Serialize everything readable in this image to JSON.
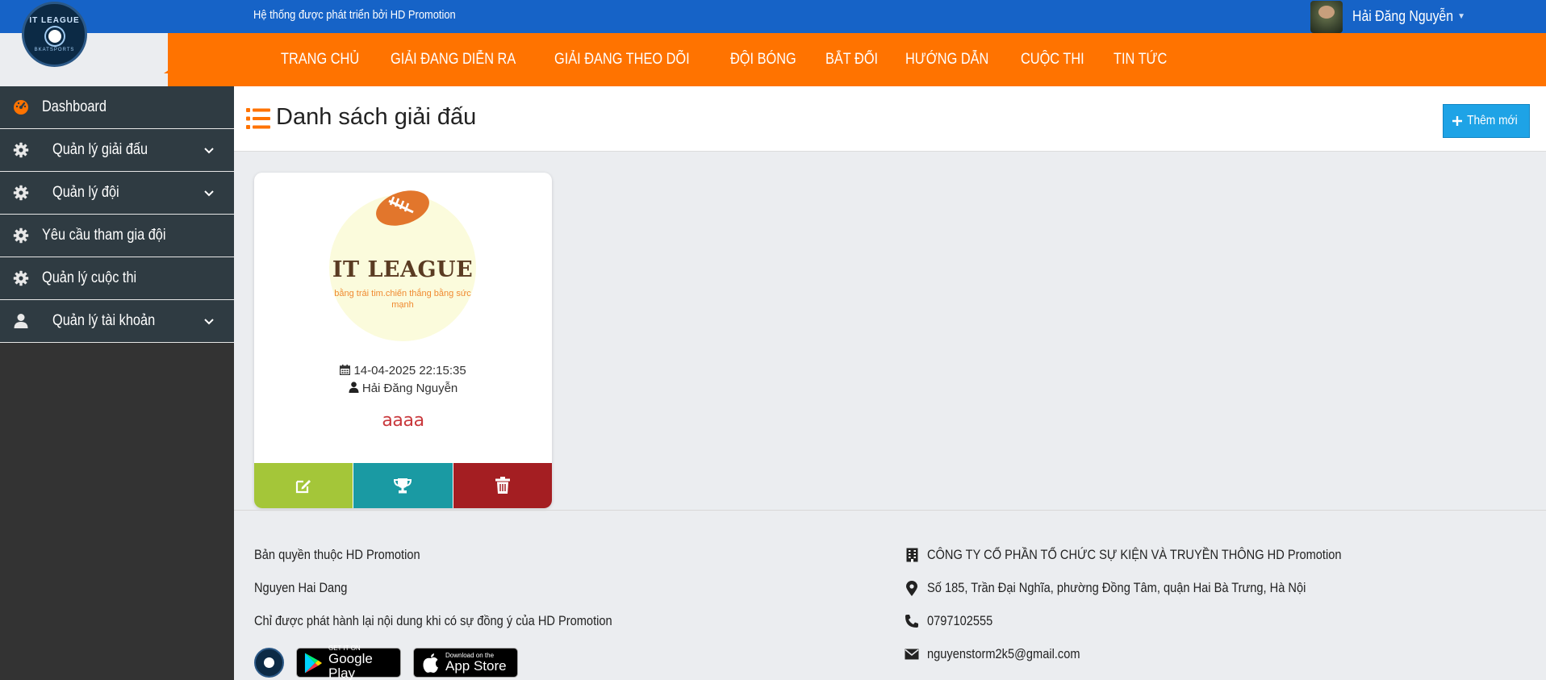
{
  "header": {
    "system_text": "Hệ thống được phát triển bởi HD Promotion",
    "user_name": "Hải Đăng Nguyễn",
    "logo_text": "IT LEAGUE",
    "logo_sub": "BKATSPORTS"
  },
  "nav": {
    "items": [
      {
        "label": "TRANG CHỦ"
      },
      {
        "label": "GIẢI ĐANG DIỄN RA"
      },
      {
        "label": "GIẢI ĐANG THEO DÕI"
      },
      {
        "label": "ĐỘI BÓNG"
      },
      {
        "label": "BẮT ĐỐI"
      },
      {
        "label": "HƯỚNG DẪN"
      },
      {
        "label": "CUỘC THI"
      },
      {
        "label": "TIN TỨC"
      }
    ]
  },
  "sidebar": {
    "items": [
      {
        "label": "Dashboard",
        "icon": "dashboard-icon"
      },
      {
        "label": "Quản lý giải đấu",
        "icon": "gear-icon"
      },
      {
        "label": "Quản lý đội",
        "icon": "gear-icon"
      },
      {
        "label": "Yêu cầu tham gia đội",
        "icon": "gear-icon"
      },
      {
        "label": "Quản lý cuộc thi",
        "icon": "gear-icon"
      },
      {
        "label": "Quản lý tài khoản",
        "icon": "user-icon"
      }
    ]
  },
  "main": {
    "title": "Danh sách giải đấu",
    "add_button": "Thêm mới"
  },
  "tournaments": [
    {
      "logo_title": "IT LEAGUE",
      "logo_sub": "bằng trái tim.chiến thắng bằng sức mạnh",
      "date": "14-04-2025 22:15:35",
      "author": "Hải Đăng Nguyễn",
      "name": "aaaa"
    }
  ],
  "footer": {
    "copyright": "Bản quyền thuộc HD Promotion",
    "author": "Nguyen Hai Dang",
    "notice": "Chỉ được phát hành lại nội dung khi có sự đồng ý của HD Promotion",
    "company": "CÔNG TY CỔ PHẦN TỔ CHỨC SỰ KIỆN VÀ TRUYỀN THÔNG HD Promotion",
    "address": "Số 185, Trần Đại Nghĩa, phường Đồng Tâm, quận Hai Bà Trưng, Hà Nội",
    "phone": "0797102555",
    "email": "nguyenstorm2k5@gmail.com",
    "google_play_small": "GET IT ON",
    "google_play_big": "Google Play",
    "app_store_small": "Download on the",
    "app_store_big": "App Store"
  },
  "colors": {
    "header_blue": "#1663c7",
    "nav_orange": "#ff7300",
    "sidebar_bg": "#2f3b42",
    "add_button": "#1ea3e6",
    "edit_green": "#a4c639",
    "trophy_teal": "#1a9aa3",
    "delete_red": "#a41e22"
  }
}
